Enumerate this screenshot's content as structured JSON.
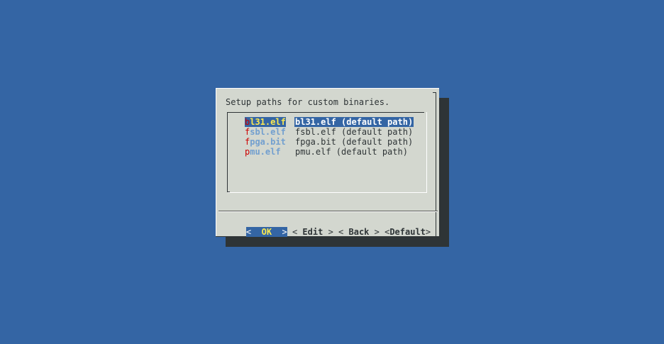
{
  "dialog": {
    "prompt": "Setup paths for custom binaries.",
    "items": [
      {
        "hotkey": "b",
        "tag_rest": "l31.elf",
        "description": "bl31.elf (default path)",
        "selected": true
      },
      {
        "hotkey": "f",
        "tag_rest": "sbl.elf",
        "description": "fsbl.elf (default path)",
        "selected": false
      },
      {
        "hotkey": "f",
        "tag_rest": "pga.bit",
        "description": "fpga.bit (default path)",
        "selected": false
      },
      {
        "hotkey": "p",
        "tag_rest": "mu.elf",
        "description": "pmu.elf (default path)",
        "selected": false
      }
    ],
    "buttons": {
      "ok": {
        "open": "<",
        "label": "  OK  ",
        "close": ">"
      },
      "edit": {
        "open": "<",
        "label": " Edit ",
        "close": ">"
      },
      "back": {
        "open": "<",
        "label": " Back ",
        "close": ">"
      },
      "default": {
        "open": "<",
        "label": "Default",
        "close": ">"
      }
    }
  },
  "colors": {
    "background": "#3465a4",
    "dialog": "#d3d7cf",
    "shadow": "#2e3436",
    "selection": "#3465a4",
    "hotkey": "#cc0000",
    "tag": "#729fcf",
    "highlight_text": "#fce94f"
  }
}
